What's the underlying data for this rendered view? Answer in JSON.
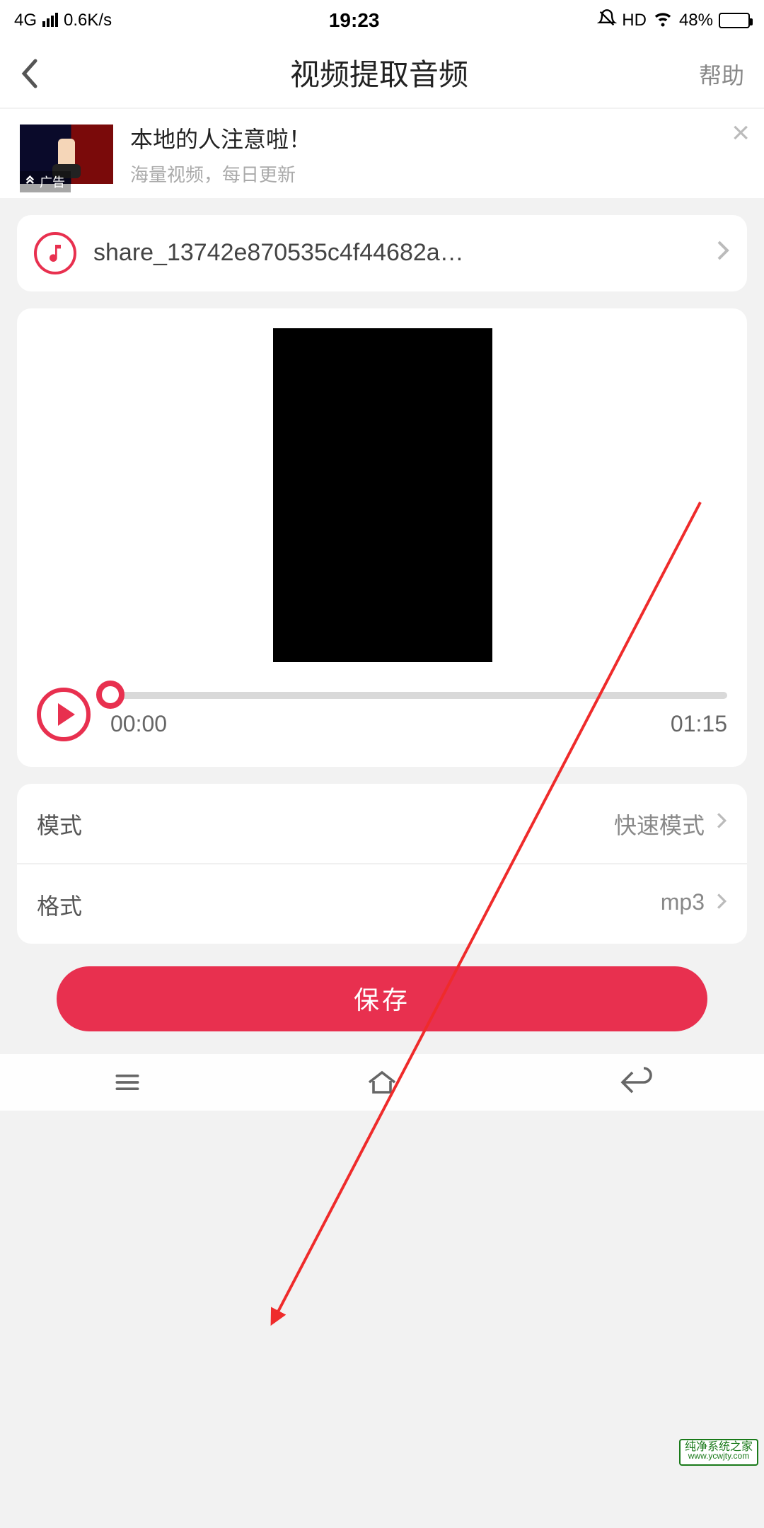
{
  "status": {
    "network_type": "4G",
    "speed": "0.6K/s",
    "time": "19:23",
    "hd": "HD",
    "battery_pct": "48%"
  },
  "header": {
    "title": "视频提取音频",
    "help_label": "帮助"
  },
  "ad": {
    "badge": "广告",
    "title": "本地的人注意啦！",
    "subtitle": "海量视频，每日更新"
  },
  "file": {
    "name": "share_13742e870535c4f44682a…"
  },
  "player": {
    "current": "00:00",
    "duration": "01:15"
  },
  "settings": {
    "mode_label": "模式",
    "mode_value": "快速模式",
    "format_label": "格式",
    "format_value": "mp3"
  },
  "save_label": "保存",
  "watermark": {
    "name": "纯净系统之家",
    "url": "www.ycwjty.com"
  }
}
